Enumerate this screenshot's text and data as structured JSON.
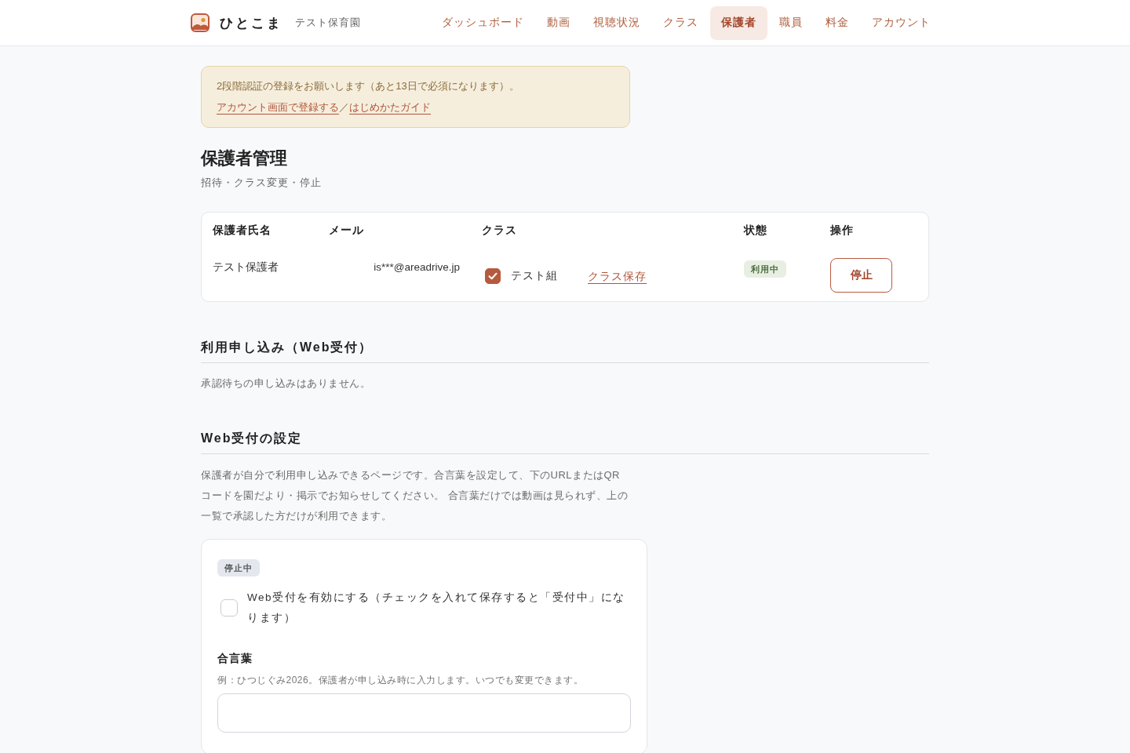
{
  "header": {
    "app_name": "ひとこま",
    "org_name": "テスト保育園",
    "nav": [
      {
        "label": "ダッシュボード",
        "selected": false
      },
      {
        "label": "動画",
        "selected": false
      },
      {
        "label": "視聴状況",
        "selected": false
      },
      {
        "label": "クラス",
        "selected": false
      },
      {
        "label": "保護者",
        "selected": true
      },
      {
        "label": "職員",
        "selected": false
      },
      {
        "label": "料金",
        "selected": false
      },
      {
        "label": "アカウント",
        "selected": false
      }
    ]
  },
  "notice": {
    "text": "2段階認証の登録をお願いします（あと13日で必須になります）。",
    "links": [
      "アカウント画面で登録する",
      "はじめかたガイド"
    ],
    "separator": "／"
  },
  "page": {
    "title": "保護者管理",
    "subtitle": "招待・クラス変更・停止"
  },
  "guardians_table": {
    "columns": [
      "保護者氏名",
      "メール",
      "クラス",
      "状態",
      "操作"
    ],
    "rows": [
      {
        "name": "テスト保護者",
        "email": "is***@areadrive.jp",
        "classes": [
          {
            "label": "テスト組",
            "checked": true
          }
        ],
        "save_link": "クラス保存",
        "status": {
          "label": "利用中",
          "kind": "active"
        },
        "action": "停止"
      }
    ]
  },
  "applications": {
    "heading": "利用申し込み（Web受付）",
    "empty_text": "承認待ちの申し込みはありません。"
  },
  "web_settings": {
    "heading": "Web受付の設定",
    "description": "保護者が自分で利用申し込みできるページです。合言葉を設定して、下のURLまたはQRコードを園だより・掲示でお知らせしてください。 合言葉だけでは動画は見られず、上の一覧で承認した方だけが利用できます。",
    "status": {
      "label": "停止中",
      "kind": "stopped"
    },
    "enable": {
      "label": "Web受付を有効にする（チェックを入れて保存すると「受付中」になります）",
      "checked": false
    },
    "passphrase": {
      "label": "合言葉",
      "hint": "例：ひつじぐみ2026。保護者が申し込み時に入力します。いつでも変更できます。"
    }
  }
}
